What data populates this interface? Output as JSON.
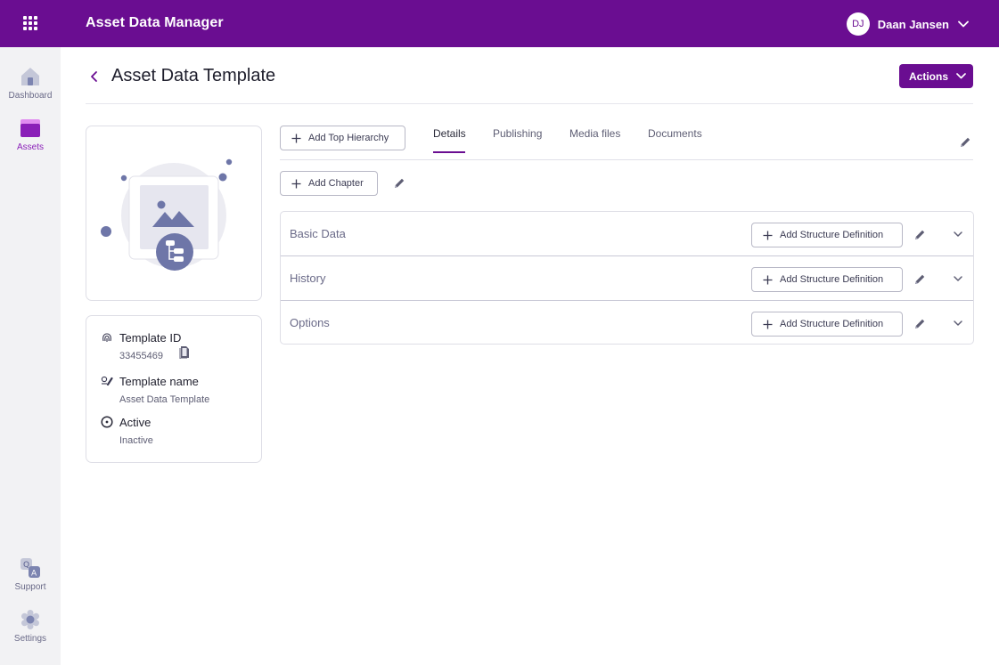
{
  "app": {
    "title": "Asset Data Manager"
  },
  "user": {
    "initials": "DJ",
    "name": "Daan Jansen"
  },
  "sidebar": {
    "items": [
      {
        "label": "Dashboard",
        "icon": "home-icon"
      },
      {
        "label": "Assets",
        "icon": "assets-icon",
        "active": true
      },
      {
        "label": "Support",
        "icon": "qa-icon"
      },
      {
        "label": "Settings",
        "icon": "gear-icon"
      }
    ]
  },
  "header": {
    "title": "Asset Data Template",
    "actions_label": "Actions"
  },
  "template_info": {
    "id_label": "Template ID",
    "id_value": "33455469",
    "name_label": "Template name",
    "name_value": "Asset Data Template",
    "active_label": "Active",
    "active_value": "Inactive"
  },
  "toolbar": {
    "add_top_hierarchy": "Add Top Hierarchy",
    "add_chapter": "Add Chapter"
  },
  "tabs": [
    {
      "label": "Details",
      "active": true
    },
    {
      "label": "Publishing"
    },
    {
      "label": "Media files"
    },
    {
      "label": "Documents"
    }
  ],
  "chapters": [
    {
      "name": "Basic Data",
      "button": "Add Structure Definition"
    },
    {
      "name": "History",
      "button": "Add Structure Definition"
    },
    {
      "name": "Options",
      "button": "Add Structure Definition"
    }
  ],
  "colors": {
    "brand": "#6a0d91",
    "accent": "#8a1fb8",
    "illustration": "#6e76a8"
  }
}
